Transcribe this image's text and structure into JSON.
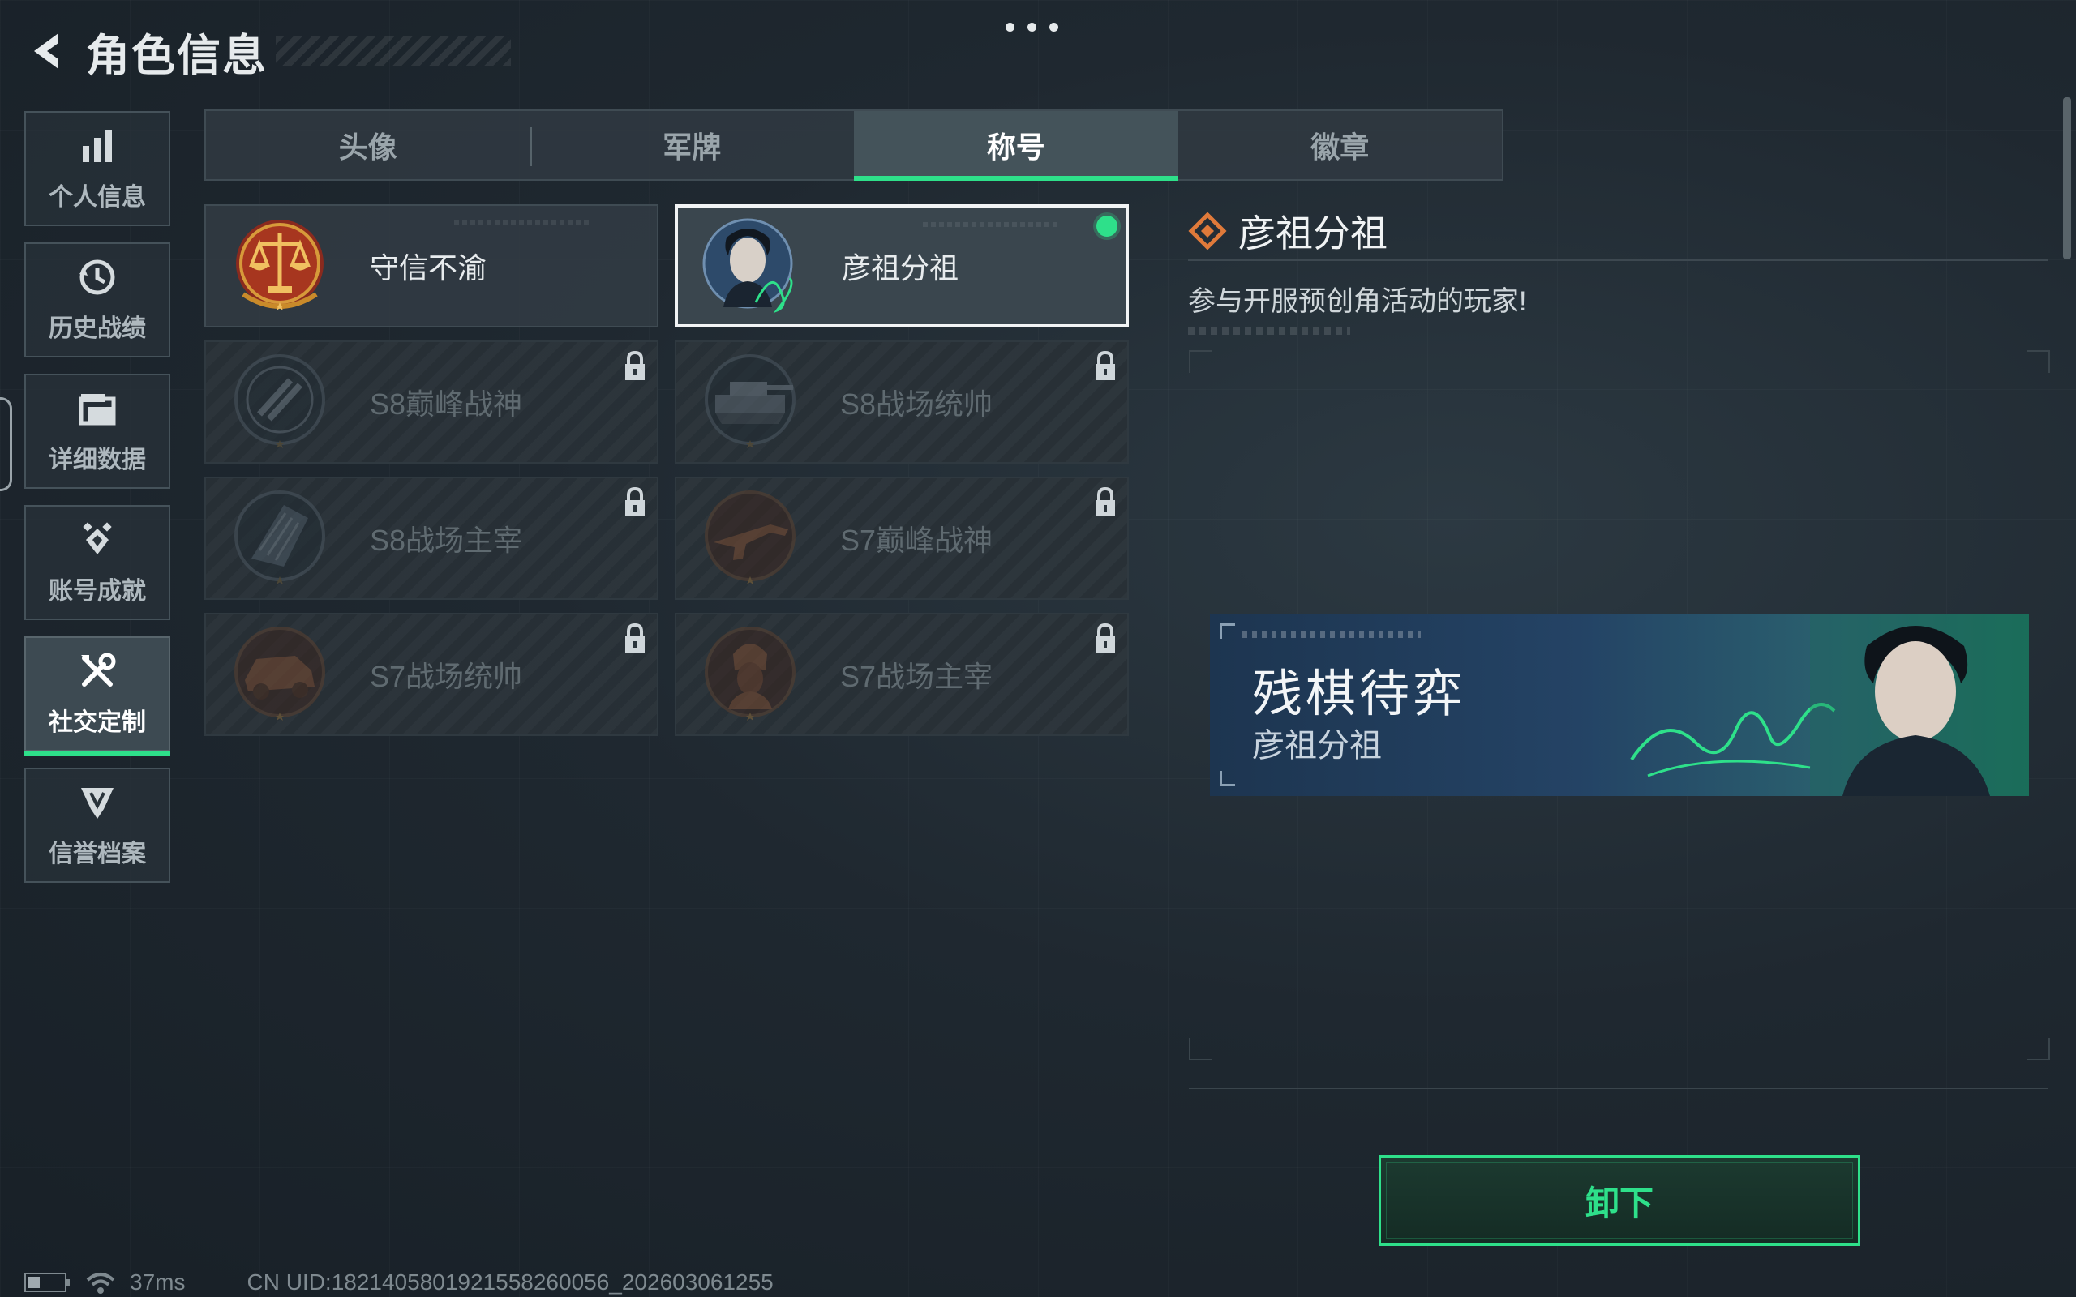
{
  "header": {
    "title": "角色信息"
  },
  "sidebar": {
    "items": [
      {
        "label": "个人信息",
        "icon": "bar-chart-icon"
      },
      {
        "label": "历史战绩",
        "icon": "history-icon"
      },
      {
        "label": "详细数据",
        "icon": "folder-icon"
      },
      {
        "label": "账号成就",
        "icon": "achievement-icon"
      },
      {
        "label": "社交定制",
        "icon": "tools-icon",
        "active": true
      },
      {
        "label": "信誉档案",
        "icon": "credit-shield-icon"
      }
    ]
  },
  "tabs": [
    {
      "label": "头像"
    },
    {
      "label": "军牌"
    },
    {
      "label": "称号",
      "active": true
    },
    {
      "label": "徽章"
    }
  ],
  "titles": [
    {
      "name": "守信不渝",
      "locked": false
    },
    {
      "name": "彦祖分祖",
      "locked": false,
      "selected": true,
      "equipped": true
    },
    {
      "name": "S8巅峰战神",
      "locked": true
    },
    {
      "name": "S8战场统帅",
      "locked": true
    },
    {
      "name": "S8战场主宰",
      "locked": true
    },
    {
      "name": "S7巅峰战神",
      "locked": true
    },
    {
      "name": "S7战场统帅",
      "locked": true
    },
    {
      "name": "S7战场主宰",
      "locked": true
    }
  ],
  "detail": {
    "title": "彦祖分祖",
    "description": "参与开服预创角活动的玩家!"
  },
  "banner": {
    "main_text": "残棋待弈",
    "sub_text": "彦祖分祖"
  },
  "actions": {
    "unequip_label": "卸下"
  },
  "status": {
    "ping": "37ms",
    "uid": "CN UID:1821405801921558260056_202603061255"
  },
  "colors": {
    "accent": "#2ee08a",
    "gold": "#c98a2a",
    "orange": "#e07a3a"
  }
}
